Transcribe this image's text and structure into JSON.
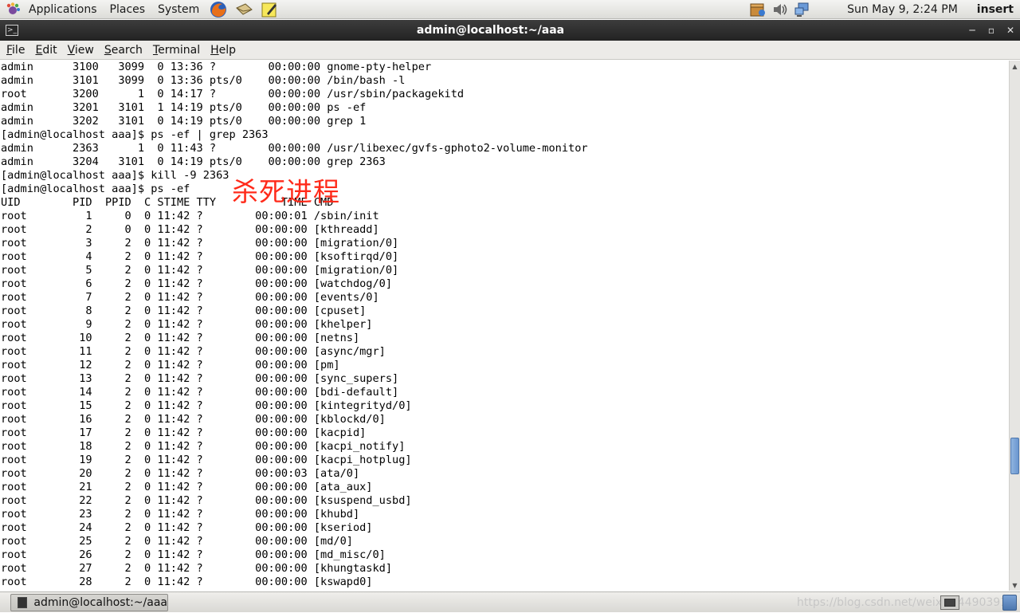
{
  "top_panel": {
    "menus": [
      "Applications",
      "Places",
      "System"
    ],
    "clock": "Sun May  9,  2:24 PM",
    "mode": "insert"
  },
  "window": {
    "title": "admin@localhost:~/aaa"
  },
  "menubar": [
    {
      "first": "F",
      "rest": "ile"
    },
    {
      "first": "E",
      "rest": "dit"
    },
    {
      "first": "V",
      "rest": "iew"
    },
    {
      "first": "S",
      "rest": "earch"
    },
    {
      "first": "T",
      "rest": "erminal"
    },
    {
      "first": "H",
      "rest": "elp"
    }
  ],
  "terminal": {
    "lines": [
      "admin      3100   3099  0 13:36 ?        00:00:00 gnome-pty-helper",
      "admin      3101   3099  0 13:36 pts/0    00:00:00 /bin/bash -l",
      "root       3200      1  0 14:17 ?        00:00:00 /usr/sbin/packagekitd",
      "admin      3201   3101  1 14:19 pts/0    00:00:00 ps -ef",
      "admin      3202   3101  0 14:19 pts/0    00:00:00 grep 1",
      "[admin@localhost aaa]$ ps -ef | grep 2363",
      "admin      2363      1  0 11:43 ?        00:00:00 /usr/libexec/gvfs-gphoto2-volume-monitor",
      "admin      3204   3101  0 14:19 pts/0    00:00:00 grep 2363",
      "[admin@localhost aaa]$ kill -9 2363",
      "[admin@localhost aaa]$ ps -ef",
      "UID        PID  PPID  C STIME TTY          TIME CMD",
      "root         1     0  0 11:42 ?        00:00:01 /sbin/init",
      "root         2     0  0 11:42 ?        00:00:00 [kthreadd]",
      "root         3     2  0 11:42 ?        00:00:00 [migration/0]",
      "root         4     2  0 11:42 ?        00:00:00 [ksoftirqd/0]",
      "root         5     2  0 11:42 ?        00:00:00 [migration/0]",
      "root         6     2  0 11:42 ?        00:00:00 [watchdog/0]",
      "root         7     2  0 11:42 ?        00:00:00 [events/0]",
      "root         8     2  0 11:42 ?        00:00:00 [cpuset]",
      "root         9     2  0 11:42 ?        00:00:00 [khelper]",
      "root        10     2  0 11:42 ?        00:00:00 [netns]",
      "root        11     2  0 11:42 ?        00:00:00 [async/mgr]",
      "root        12     2  0 11:42 ?        00:00:00 [pm]",
      "root        13     2  0 11:42 ?        00:00:00 [sync_supers]",
      "root        14     2  0 11:42 ?        00:00:00 [bdi-default]",
      "root        15     2  0 11:42 ?        00:00:00 [kintegrityd/0]",
      "root        16     2  0 11:42 ?        00:00:00 [kblockd/0]",
      "root        17     2  0 11:42 ?        00:00:00 [kacpid]",
      "root        18     2  0 11:42 ?        00:00:00 [kacpi_notify]",
      "root        19     2  0 11:42 ?        00:00:00 [kacpi_hotplug]",
      "root        20     2  0 11:42 ?        00:00:03 [ata/0]",
      "root        21     2  0 11:42 ?        00:00:00 [ata_aux]",
      "root        22     2  0 11:42 ?        00:00:00 [ksuspend_usbd]",
      "root        23     2  0 11:42 ?        00:00:00 [khubd]",
      "root        24     2  0 11:42 ?        00:00:00 [kseriod]",
      "root        25     2  0 11:42 ?        00:00:00 [md/0]",
      "root        26     2  0 11:42 ?        00:00:00 [md_misc/0]",
      "root        27     2  0 11:42 ?        00:00:00 [khungtaskd]",
      "root        28     2  0 11:42 ?        00:00:00 [kswapd0]"
    ],
    "annotation": "杀死进程",
    "annotation_color": "#ff2a1a"
  },
  "taskbar": {
    "task_label": "admin@localhost:~/aaa",
    "watermark": "https://blog.csdn.net/weixin_44903911"
  },
  "icons": {
    "apps": "gnome-foot-icon",
    "launchers": [
      "firefox-icon",
      "mail-icon",
      "text-editor-icon"
    ],
    "tray": [
      "package-updater-icon",
      "volume-icon",
      "network-icon"
    ]
  }
}
